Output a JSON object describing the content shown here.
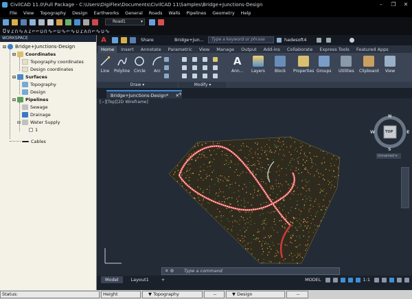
{
  "window": {
    "title": "CivilCAD 11.0\\Full Package - C:\\Users\\DigiFlex\\Documents\\CivilCAD 11\\Samples\\Bridge+Junctions-Design",
    "controls": [
      "–",
      "❐",
      "✕"
    ]
  },
  "menu": [
    "File",
    "View",
    "Topography",
    "Design",
    "Earthworks",
    "General",
    "Roads",
    "Walls",
    "Pipelines",
    "Geometry",
    "Help"
  ],
  "toolbar": {
    "road_select": "Road1",
    "road_icons": "Ʊ∨ɾ∩∿ʌɾ⌐⌐∪∩∿⌐∪∿⌐∿∪ɾʌ∩⌐∿∪∿"
  },
  "workspace": {
    "header": "WORKSPACE",
    "root": "Bridge+Junctions-Design",
    "nodes": {
      "coordinates": "Coordinates",
      "topography_coordinates": "Topography coordinates",
      "design_coordinates": "Design coordinates",
      "surfaces": "Surfaces",
      "topography": "Topography",
      "design": "Design",
      "pipelines": "Pipelines",
      "sewage": "Sewage",
      "drainage": "Drainage",
      "water_supply": "Water Supply",
      "water_1": "1",
      "cables": "Cables"
    }
  },
  "acad": {
    "logo": "A",
    "share": "Share",
    "file_title": "Bridge+Jun...",
    "search_placeholder": "Type a keyword or phrase",
    "user": "hadesoft4",
    "ribbon_tabs": [
      "Home",
      "Insert",
      "Annotate",
      "Parametric",
      "View",
      "Manage",
      "Output",
      "Add-ins",
      "Collaborate",
      "Express Tools",
      "Featured Apps"
    ],
    "draw_tools": {
      "line": "Line",
      "polyline": "Polyline",
      "circle": "Circle",
      "arc": "Arc"
    },
    "panels": {
      "draw": "Draw ▾",
      "modify": "Modify ▾"
    },
    "big_buttons": {
      "annotation": "Ann...",
      "layers": "Layers",
      "block": "Block",
      "properties": "Properties",
      "groups": "Groups",
      "utilities": "Utilities",
      "clipboard": "Clipboard",
      "view": "View"
    },
    "doc_tab": "Bridge+Junctions-Design*",
    "doc_close": "✕",
    "viewport_label": "[−][Top][2D Wireframe]",
    "viewcube": {
      "n": "N",
      "s": "S",
      "e": "E",
      "w": "W",
      "top": "TOP",
      "ucs": "Unnamed ▾"
    },
    "command_placeholder": "Type a command",
    "layout_tabs": [
      "Model",
      "Layout1"
    ],
    "status": {
      "model": "MODEL",
      "scale": "1:1"
    }
  },
  "statusbar": {
    "status_label": "Status:",
    "height_label": "Height",
    "topo_label": "Topography",
    "topo_val": "--",
    "design_label": "Design",
    "design_val": "--"
  },
  "colors": {
    "terrain_yellow": "#e8c24a",
    "terrain_green": "#4f8a2a",
    "terrain_orange": "#d9772b",
    "road_white": "#e6e6e6",
    "road_red": "#d33a3a",
    "accent_blue": "#3c8fd8"
  }
}
